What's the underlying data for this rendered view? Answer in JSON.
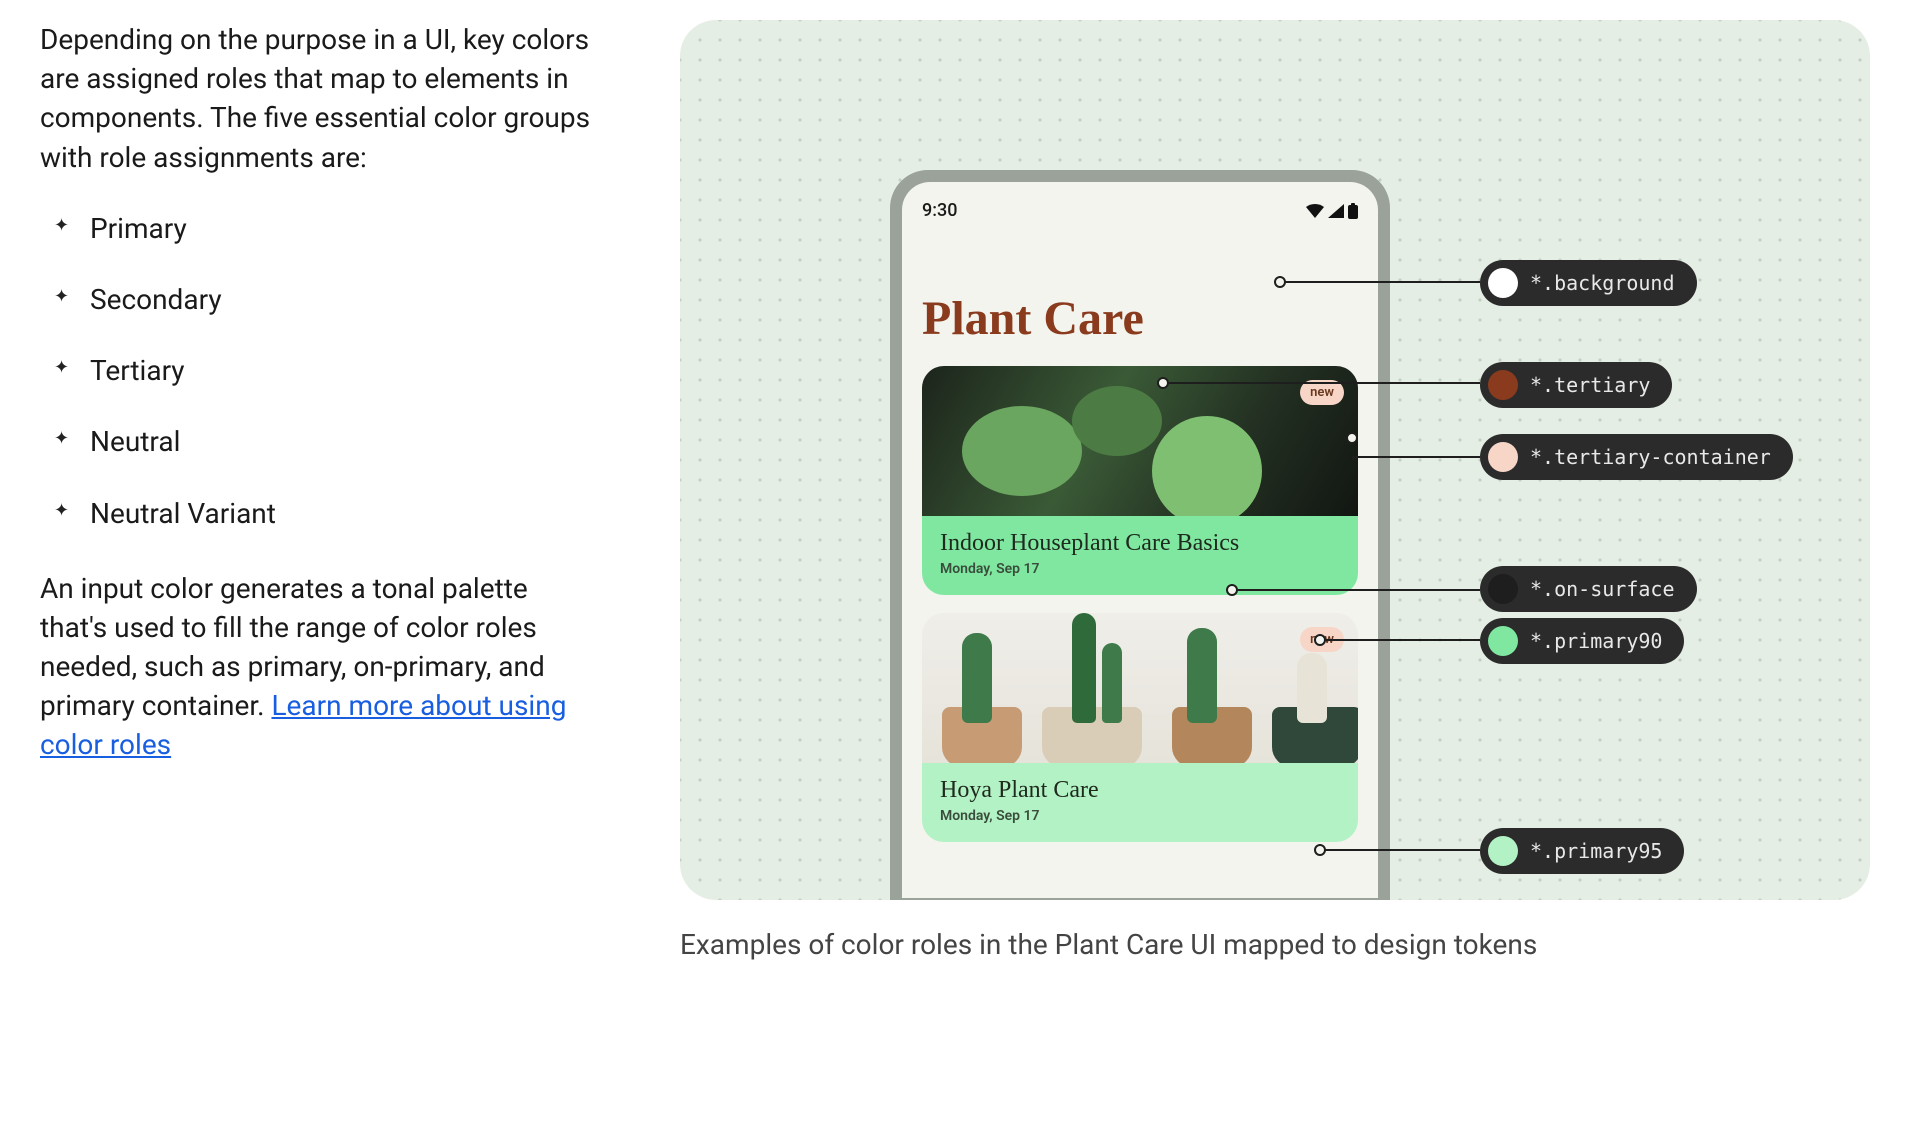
{
  "left": {
    "intro": "Depending on the purpose in a UI, key colors are assigned roles that map to elements in components. The five essential color groups with role assignments are:",
    "groups": [
      "Primary",
      "Secondary",
      "Tertiary",
      "Neutral",
      "Neutral Variant"
    ],
    "outro_before_link": "An input color generates a tonal palette that's used to fill the range of color roles needed, such as primary, on-primary, and primary container. ",
    "link_text": "Learn more about using color roles"
  },
  "phone": {
    "time": "9:30",
    "app_title": "Plant Care",
    "cards": [
      {
        "title": "Indoor Houseplant Care Basics",
        "date": "Monday, Sep 17",
        "badge": "new"
      },
      {
        "title": "Hoya Plant Care",
        "date": "Monday, Sep 17",
        "badge": "new"
      }
    ]
  },
  "annotations": [
    {
      "label": "*.background",
      "swatch": "#ffffff"
    },
    {
      "label": "*.tertiary",
      "swatch": "#8a3b1e"
    },
    {
      "label": "*.tertiary-container",
      "swatch": "#f7d6c7"
    },
    {
      "label": "*.on-surface",
      "swatch": "#1e1e1e"
    },
    {
      "label": "*.primary90",
      "swatch": "#7fe7a0"
    },
    {
      "label": "*.primary95",
      "swatch": "#b3f2c4"
    }
  ],
  "caption": "Examples of color roles in the Plant Care UI mapped to design tokens"
}
